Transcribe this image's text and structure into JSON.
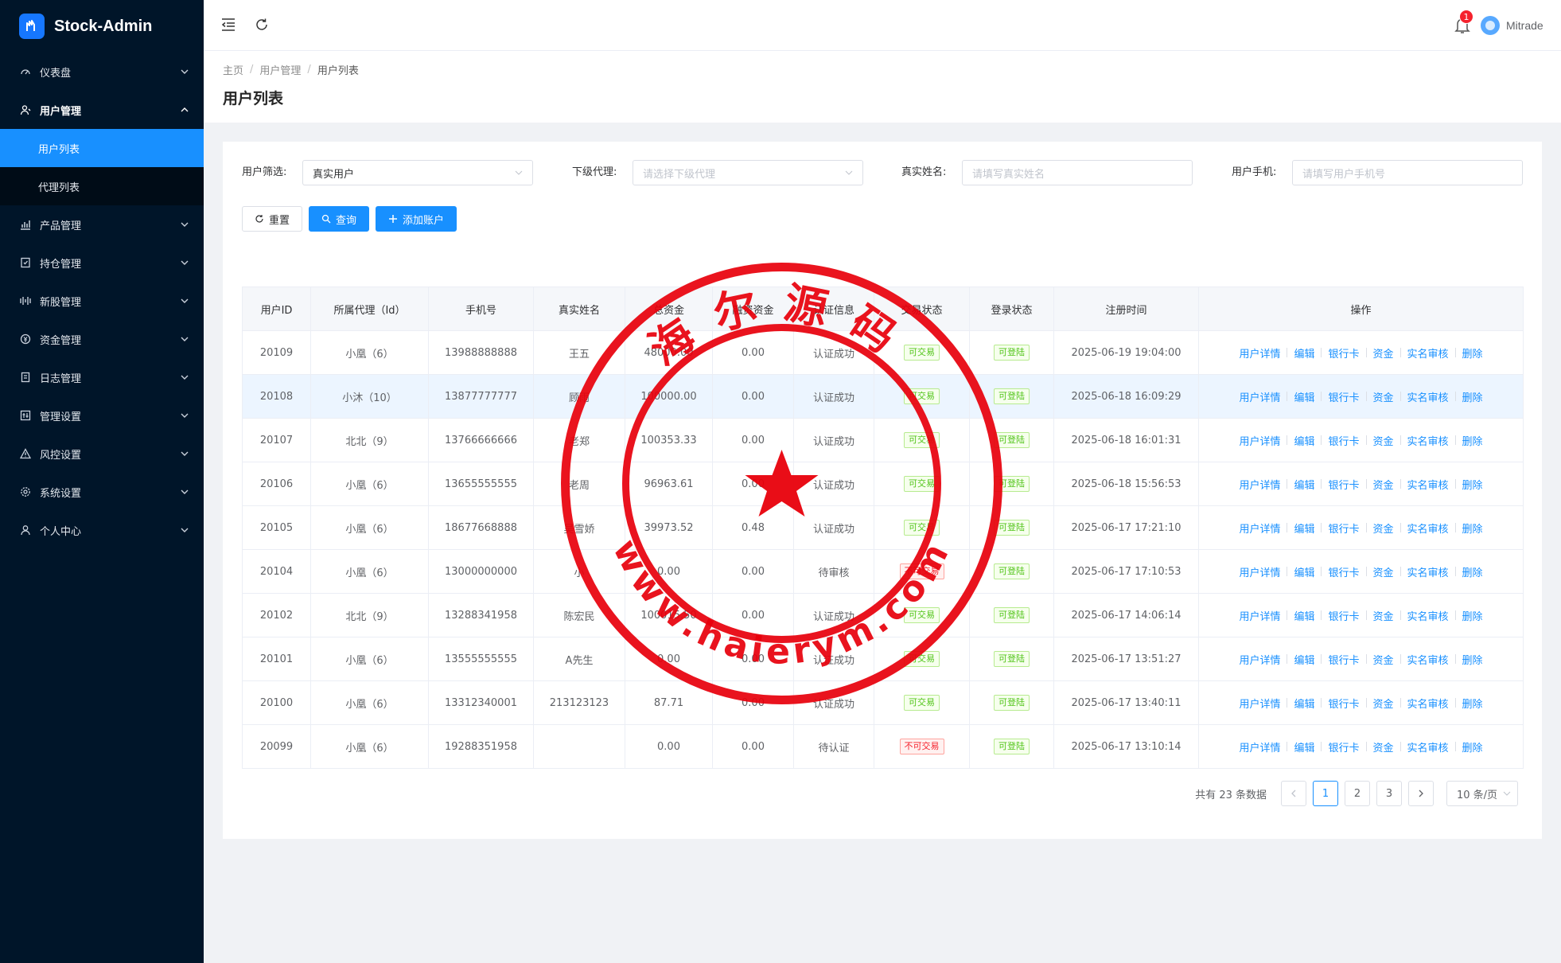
{
  "app": {
    "name": "Stock-Admin"
  },
  "sidebar": {
    "items": [
      {
        "label": "仪表盘",
        "icon": "dashboard-icon",
        "open": false
      },
      {
        "label": "用户管理",
        "icon": "user-manage-icon",
        "open": true,
        "children": [
          {
            "label": "用户列表",
            "active": true
          },
          {
            "label": "代理列表",
            "active": false
          }
        ]
      },
      {
        "label": "产品管理",
        "icon": "chart-icon",
        "open": false
      },
      {
        "label": "持仓管理",
        "icon": "position-icon",
        "open": false
      },
      {
        "label": "新股管理",
        "icon": "ipo-icon",
        "open": false
      },
      {
        "label": "资金管理",
        "icon": "money-icon",
        "open": false
      },
      {
        "label": "日志管理",
        "icon": "log-icon",
        "open": false
      },
      {
        "label": "管理设置",
        "icon": "admin-setting-icon",
        "open": false
      },
      {
        "label": "风控设置",
        "icon": "warning-icon",
        "open": false
      },
      {
        "label": "系统设置",
        "icon": "gear-icon",
        "open": false
      },
      {
        "label": "个人中心",
        "icon": "person-icon",
        "open": false
      }
    ]
  },
  "header": {
    "notification_count": "1",
    "username": "Mitrade"
  },
  "breadcrumb": [
    "主页",
    "用户管理",
    "用户列表"
  ],
  "page_title": "用户列表",
  "filters": {
    "user_filter_label": "用户筛选:",
    "user_filter_value": "真实用户",
    "agent_label": "下级代理:",
    "agent_placeholder": "请选择下级代理",
    "realname_label": "真实姓名:",
    "realname_placeholder": "请填写真实姓名",
    "phone_label": "用户手机:",
    "phone_placeholder": "请填写用户手机号"
  },
  "buttons": {
    "reset": "重置",
    "search": "查询",
    "add": "添加账户"
  },
  "table": {
    "columns": [
      "用户ID",
      "所属代理（Id）",
      "手机号",
      "真实姓名",
      "总资金",
      "融资资金",
      "认证信息",
      "交易状态",
      "登录状态",
      "注册时间",
      "操作"
    ],
    "ops": [
      "用户详情",
      "编辑",
      "银行卡",
      "资金",
      "实名审核",
      "删除"
    ],
    "rows": [
      {
        "id": "20109",
        "agent": "小凰（6）",
        "phone": "13988888888",
        "name": "王五",
        "total": "48000.00",
        "margin": "0.00",
        "auth": "认证成功",
        "trade": "可交易",
        "trade_ok": true,
        "login": "可登陆",
        "reg": "2025-06-19 19:04:00"
      },
      {
        "id": "20108",
        "agent": "小沐（10）",
        "phone": "13877777777",
        "name": "顾雨",
        "total": "100000.00",
        "margin": "0.00",
        "auth": "认证成功",
        "trade": "可交易",
        "trade_ok": true,
        "login": "可登陆",
        "reg": "2025-06-18 16:09:29"
      },
      {
        "id": "20107",
        "agent": "北北（9）",
        "phone": "13766666666",
        "name": "老郑",
        "total": "100353.33",
        "margin": "0.00",
        "auth": "认证成功",
        "trade": "可交易",
        "trade_ok": true,
        "login": "可登陆",
        "reg": "2025-06-18 16:01:31"
      },
      {
        "id": "20106",
        "agent": "小凰（6）",
        "phone": "13655555555",
        "name": "老周",
        "total": "96963.61",
        "margin": "0.00",
        "auth": "认证成功",
        "trade": "可交易",
        "trade_ok": true,
        "login": "可登陆",
        "reg": "2025-06-18 15:56:53"
      },
      {
        "id": "20105",
        "agent": "小凰（6）",
        "phone": "18677668888",
        "name": "吴雪娇",
        "total": "39973.52",
        "margin": "0.48",
        "auth": "认证成功",
        "trade": "可交易",
        "trade_ok": true,
        "login": "可登陆",
        "reg": "2025-06-17 17:21:10"
      },
      {
        "id": "20104",
        "agent": "小凰（6）",
        "phone": "13000000000",
        "name": "小",
        "total": "0.00",
        "margin": "0.00",
        "auth": "待审核",
        "trade": "不可交易",
        "trade_ok": false,
        "login": "可登陆",
        "reg": "2025-06-17 17:10:53"
      },
      {
        "id": "20102",
        "agent": "北北（9）",
        "phone": "13288341958",
        "name": "陈宏民",
        "total": "100015.50",
        "margin": "0.00",
        "auth": "认证成功",
        "trade": "可交易",
        "trade_ok": true,
        "login": "可登陆",
        "reg": "2025-06-17 14:06:14"
      },
      {
        "id": "20101",
        "agent": "小凰（6）",
        "phone": "13555555555",
        "name": "A先生",
        "total": "0.00",
        "margin": "0.00",
        "auth": "认证成功",
        "trade": "可交易",
        "trade_ok": true,
        "login": "可登陆",
        "reg": "2025-06-17 13:51:27"
      },
      {
        "id": "20100",
        "agent": "小凰（6）",
        "phone": "13312340001",
        "name": "213123123",
        "total": "87.71",
        "margin": "0.00",
        "auth": "认证成功",
        "trade": "可交易",
        "trade_ok": true,
        "login": "可登陆",
        "reg": "2025-06-17 13:40:11"
      },
      {
        "id": "20099",
        "agent": "小凰（6）",
        "phone": "19288351958",
        "name": "",
        "total": "0.00",
        "margin": "0.00",
        "auth": "待认证",
        "trade": "不可交易",
        "trade_ok": false,
        "login": "可登陆",
        "reg": "2025-06-17 13:10:14"
      }
    ]
  },
  "pagination": {
    "total_text": "共有 23 条数据",
    "pages": [
      "1",
      "2",
      "3"
    ],
    "current": "1",
    "page_size": "10 条/页"
  },
  "watermark": {
    "text_top": "海尔源码",
    "text_bottom": "www.haierym.com",
    "color": "#e8000b"
  },
  "colors": {
    "primary": "#1890ff",
    "sidebar_bg": "#001529",
    "success": "#52c41a",
    "danger": "#f5222d"
  }
}
